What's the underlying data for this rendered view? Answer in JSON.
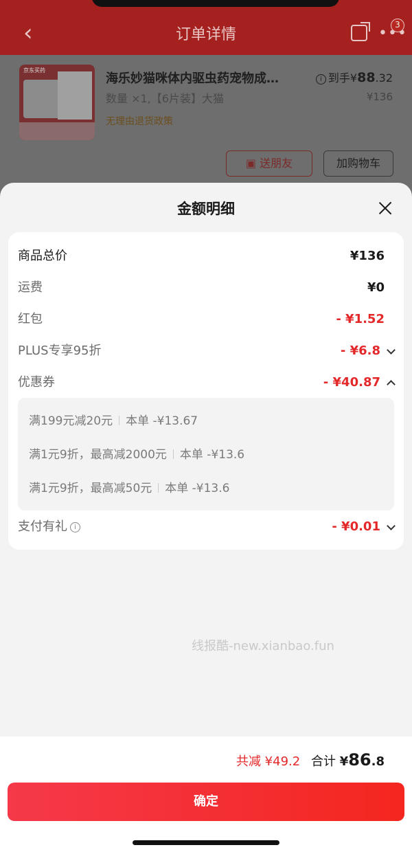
{
  "header": {
    "title": "订单详情",
    "badge_count": "3"
  },
  "product": {
    "name": "海乐妙猫咪体内驱虫药宠物成…",
    "spec": "数量 ×1,【6片装】大猫",
    "policy": "无理由退货政策",
    "price_prefix": "到手¥",
    "price_int": "88",
    "price_dec": ".32",
    "original_price": "¥136",
    "gift_button": "送朋友",
    "cart_button": "加购物车",
    "image_logo_text": "京东买药"
  },
  "sheet": {
    "title": "金额明细",
    "rows": [
      {
        "label": "商品总价",
        "value": "¥136"
      },
      {
        "label": "运费",
        "value": "¥0"
      },
      {
        "label": "红包",
        "value": "- ¥1.52"
      },
      {
        "label": "PLUS专享95折",
        "value": "- ¥6.8"
      },
      {
        "label": "优惠券",
        "value": "- ¥40.87"
      },
      {
        "label": "支付有礼",
        "value": "- ¥0.01"
      }
    ],
    "coupons": [
      {
        "rule": "满199元减20元",
        "detail": "本单 -¥13.67"
      },
      {
        "rule": "满1元9折，最高减2000元",
        "detail": "本单 -¥13.6"
      },
      {
        "rule": "满1元9折，最高减50元",
        "detail": "本单 -¥13.6"
      }
    ]
  },
  "watermark": "线报酷-new.xianbao.fun",
  "footer": {
    "saved": "共减 ¥49.2",
    "total_label": "合计",
    "total_currency": "¥",
    "total_int": "86",
    "total_dec": ".8",
    "confirm": "确定"
  },
  "colors": {
    "accent_red": "#e4282a",
    "button_gradient_start": "#f5394a",
    "button_gradient_end": "#f4261f",
    "sheet_bg": "#f3f3f3"
  },
  "icons": [
    "back-icon",
    "share-icon",
    "more-icon",
    "gift-icon",
    "info-icon",
    "close-icon",
    "chevron-down-icon",
    "chevron-up-icon"
  ]
}
